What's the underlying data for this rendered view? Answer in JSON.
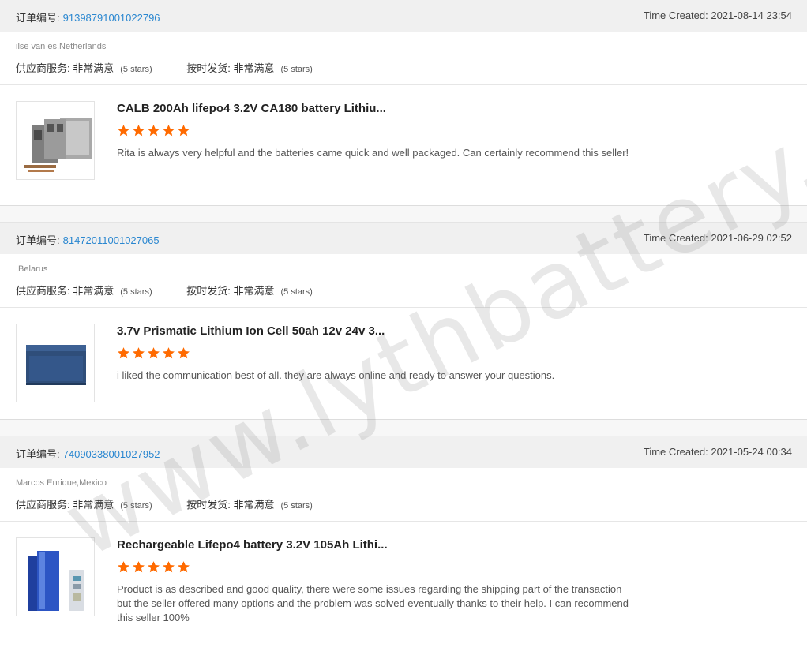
{
  "reviews": [
    {
      "order_label": "订单编号:",
      "order_number": "91398791001022796",
      "time_created": "Time Created: 2021-08-14 23:54",
      "buyer": "ilse van es,Netherlands",
      "supplier_service_label": "供应商服务:",
      "supplier_service_value": "非常满意",
      "supplier_service_stars": "(5 stars)",
      "shipping_label": "按时发货:",
      "shipping_value": "非常满意",
      "shipping_stars": "(5 stars)",
      "product_title": "CALB 200Ah lifepo4 3.2V CA180 battery Lithiu...",
      "rating": 5,
      "comment": "Rita is always very helpful and the batteries came quick and well packaged. Can certainly recommend this seller!"
    },
    {
      "order_label": "订单编号:",
      "order_number": "81472011001027065",
      "time_created": "Time Created: 2021-06-29 02:52",
      "buyer": ",Belarus",
      "supplier_service_label": "供应商服务:",
      "supplier_service_value": "非常满意",
      "supplier_service_stars": "(5 stars)",
      "shipping_label": "按时发货:",
      "shipping_value": "非常满意",
      "shipping_stars": "(5 stars)",
      "product_title": "3.7v Prismatic Lithium Ion Cell 50ah 12v 24v 3...",
      "rating": 5,
      "comment": "i liked the communication best of all. they are always online and ready to answer your questions."
    },
    {
      "order_label": "订单编号:",
      "order_number": "74090338001027952",
      "time_created": "Time Created: 2021-05-24 00:34",
      "buyer": "Marcos Enrique,Mexico",
      "supplier_service_label": "供应商服务:",
      "supplier_service_value": "非常满意",
      "supplier_service_stars": "(5 stars)",
      "shipping_label": "按时发货:",
      "shipping_value": "非常满意",
      "shipping_stars": "(5 stars)",
      "product_title": "Rechargeable Lifepo4 battery 3.2V 105Ah Lithi...",
      "rating": 5,
      "comment": "Product is as described and good quality, there were some issues regarding the shipping part of the transaction but the seller offered many options and the problem was solved eventually thanks to their help. I can recommend this seller 100%"
    }
  ],
  "watermark": "www.lythbattery.com",
  "colors": {
    "order_link": "#2a87d0",
    "star": "#ff6a00",
    "header_bg": "#f0f0f0"
  }
}
